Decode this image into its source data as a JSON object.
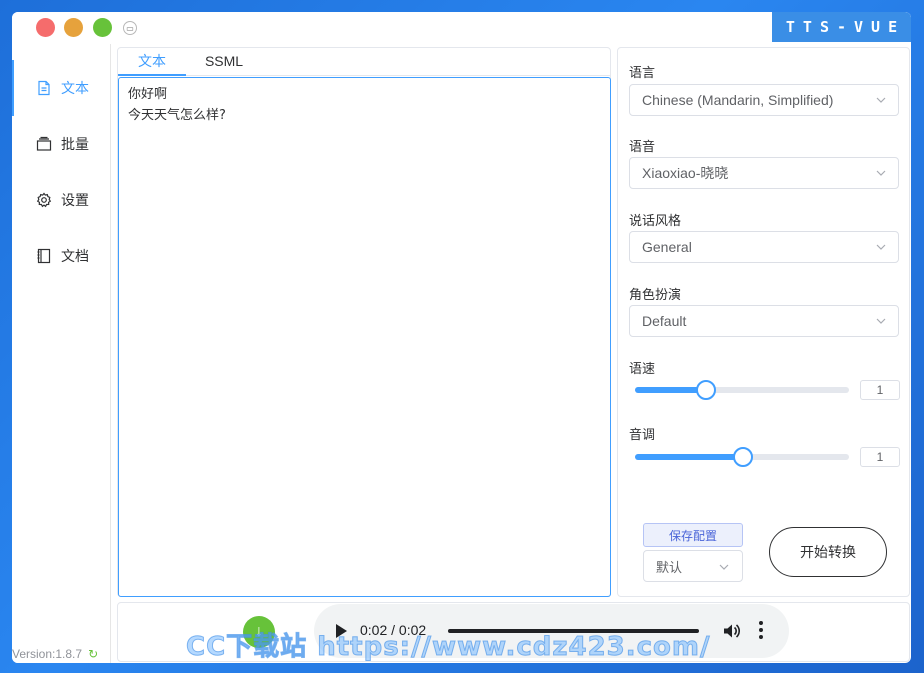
{
  "window": {
    "brand": "TTS-VUE"
  },
  "sidebar": {
    "items": [
      {
        "label": "文本",
        "icon": "document-icon",
        "active": true
      },
      {
        "label": "批量",
        "icon": "layers-icon",
        "active": false
      },
      {
        "label": "设置",
        "icon": "gear-icon",
        "active": false
      },
      {
        "label": "文档",
        "icon": "book-icon",
        "active": false
      }
    ],
    "version": "Version:1.8.7"
  },
  "editor": {
    "tabs": [
      {
        "label": "文本",
        "active": true
      },
      {
        "label": "SSML",
        "active": false
      }
    ],
    "text": "你好啊\n今天天气怎么样?"
  },
  "settings": {
    "language": {
      "label": "语言",
      "value": "Chinese (Mandarin, Simplified)"
    },
    "voice": {
      "label": "语音",
      "value": "Xiaoxiao-晓晓"
    },
    "style": {
      "label": "说话风格",
      "value": "General"
    },
    "role": {
      "label": "角色扮演",
      "value": "Default"
    },
    "rate": {
      "label": "语速",
      "value": "1",
      "fraction": 0.33
    },
    "pitch": {
      "label": "音调",
      "value": "1",
      "fraction": 0.505
    },
    "save_label": "保存配置",
    "profile_value": "默认",
    "start_label": "开始转换"
  },
  "player": {
    "time": "0:02 / 0:02"
  },
  "watermark": "CC下载站 https://www.cdz423.com/",
  "colors": {
    "accent": "#409eff",
    "success": "#67c23a",
    "brand_bg": "#3a8ee6"
  }
}
